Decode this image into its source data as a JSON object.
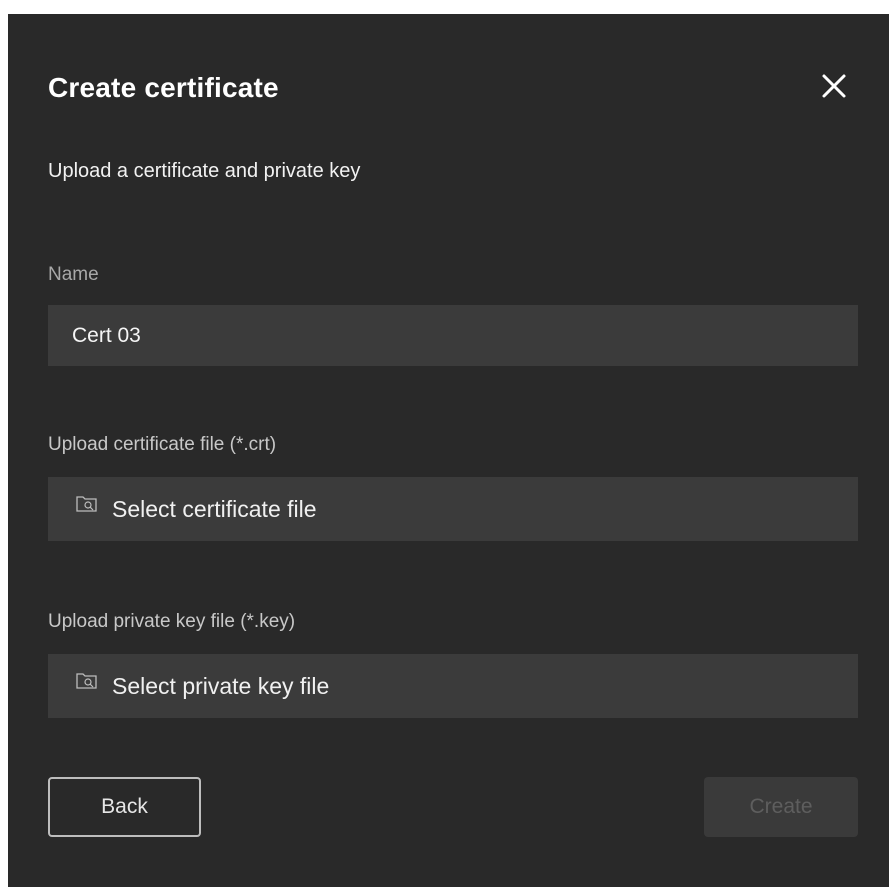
{
  "dialog": {
    "title": "Create certificate",
    "subtitle": "Upload a certificate and private key",
    "close_icon": "close-icon"
  },
  "fields": {
    "name": {
      "label": "Name",
      "value": "Cert 03"
    },
    "certificate": {
      "label": "Upload certificate file (*.crt)",
      "placeholder": "Select certificate file",
      "icon": "folder-search-icon"
    },
    "private_key": {
      "label": "Upload private key file (*.key)",
      "placeholder": "Select private key file",
      "icon": "folder-search-icon"
    }
  },
  "actions": {
    "back_label": "Back",
    "create_label": "Create"
  },
  "colors": {
    "background": "#292929",
    "field": "#3b3b3b",
    "text": "#ffffff",
    "disabled_text": "#5e5e5e"
  }
}
